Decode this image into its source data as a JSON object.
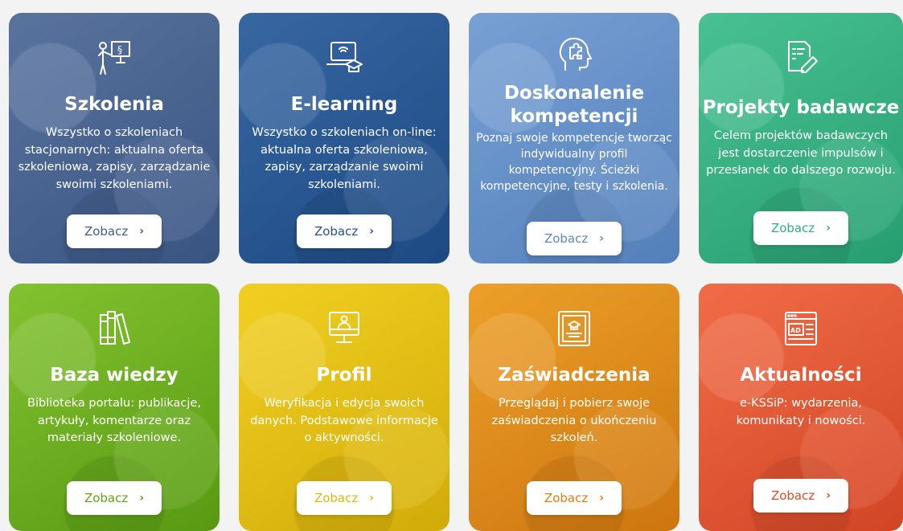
{
  "tiles": [
    {
      "icon": "presenter-icon",
      "title": "Szkolenia",
      "desc": "Wszystko o szkoleniach stacjonarnych: aktualna oferta szkoleniowa, zapisy, zarządzanie swoimi szkoleniami.",
      "button": "Zobacz",
      "color": "#4a6699"
    },
    {
      "icon": "laptop-graduation-icon",
      "title": "E-learning",
      "desc": "Wszystko o szkoleniach on-line: aktualna oferta szkoleniowa, zapisy, zarządzanie swoimi szkoleniami.",
      "button": "Zobacz",
      "color": "#24528f"
    },
    {
      "icon": "head-puzzle-icon",
      "title": "Doskonalenie kompetencji",
      "desc": "Poznaj swoje kompetencje tworząc indywidualny profil kompetencyjny. Ścieżki kompetencyjne, testy i szkolenia.",
      "button": "Zobacz",
      "color": "#5b87c2"
    },
    {
      "icon": "document-pen-icon",
      "title": "Projekty badawcze",
      "desc": "Celem projektów badawczych jest dostarczenie impulsów i przesłanek do dalszego rozwoju.",
      "button": "Zobacz",
      "color": "#2fae7c"
    },
    {
      "icon": "books-icon",
      "title": "Baza wiedzy",
      "desc": "Biblioteka portalu: publikacje, artykuły, komentarze oraz materiały szkoleniowe.",
      "button": "Zobacz",
      "color": "#5ea414"
    },
    {
      "icon": "monitor-user-icon",
      "title": "Profil",
      "desc": "Weryfikacja i edycja swoich danych. Podstawowe informacje o aktywności.",
      "button": "Zobacz",
      "color": "#e0b80a"
    },
    {
      "icon": "certificate-icon",
      "title": "Zaświadczenia",
      "desc": "Przeglądaj i pobierz swoje zaświadczenia o ukończeniu szkoleń.",
      "button": "Zobacz",
      "color": "#db7e10"
    },
    {
      "icon": "ad-browser-icon",
      "title": "Aktualności",
      "desc": "e-KSSiP: wydarzenia, komunikaty i nowości.",
      "button": "Zobacz",
      "color": "#e04a27"
    }
  ],
  "chevron": "›"
}
